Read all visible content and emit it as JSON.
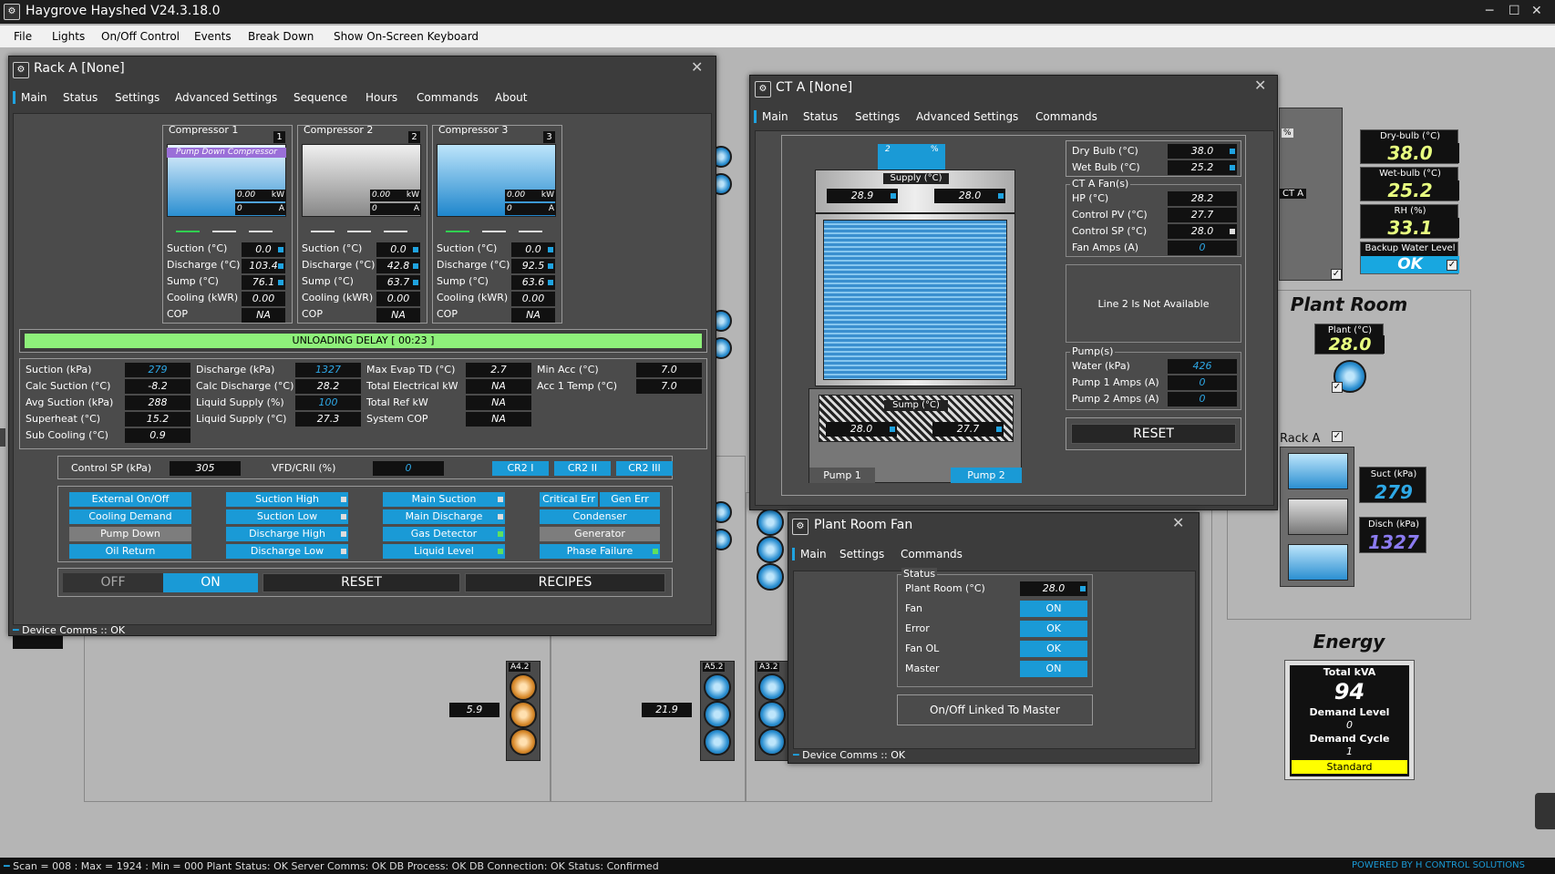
{
  "app": {
    "title": "Haygrove Hayshed V24.3.18.0",
    "menu": [
      "File",
      "Lights",
      "On/Off Control",
      "Events",
      "Break Down",
      "Show On-Screen Keyboard"
    ]
  },
  "rack_a": {
    "title": "Rack A [None]",
    "tabs": [
      "Main",
      "Status",
      "Settings",
      "Advanced Settings",
      "Sequence",
      "Hours",
      "Commands",
      "About"
    ],
    "compressors": [
      {
        "name": "Compressor 1",
        "num": "1",
        "banner": "Pump Down Compressor",
        "kw": "0.00",
        "a": "0",
        "suction": "0.0",
        "discharge": "103.4",
        "sump": "76.1",
        "cooling": "0.00",
        "cop": "NA"
      },
      {
        "name": "Compressor 2",
        "num": "2",
        "banner": "",
        "kw": "0.00",
        "a": "0",
        "suction": "0.0",
        "discharge": "42.8",
        "sump": "63.7",
        "cooling": "0.00",
        "cop": "NA"
      },
      {
        "name": "Compressor 3",
        "num": "3",
        "banner": "",
        "kw": "0.00",
        "a": "0",
        "suction": "0.0",
        "discharge": "92.5",
        "sump": "63.6",
        "cooling": "0.00",
        "cop": "NA"
      }
    ],
    "comp_labels": {
      "suction": "Suction (°C)",
      "discharge": "Discharge (°C)",
      "sump": "Sump (°C)",
      "cooling": "Cooling (kWR)",
      "cop": "COP",
      "kw_unit": "kW",
      "a_unit": "A"
    },
    "delay_banner": "UNLOADING DELAY [ 00:23 ]",
    "params": [
      [
        {
          "l": "Suction (kPa)",
          "v": "279",
          "c": "blue"
        },
        {
          "l": "Discharge (kPa)",
          "v": "1327",
          "c": "blue"
        },
        {
          "l": "Max Evap TD (°C)",
          "v": "2.7"
        },
        {
          "l": "Min Acc (°C)",
          "v": "7.0"
        }
      ],
      [
        {
          "l": "Calc Suction (°C)",
          "v": "-8.2"
        },
        {
          "l": "Calc Discharge (°C)",
          "v": "28.2"
        },
        {
          "l": "Total Electrical kW",
          "v": "NA"
        },
        {
          "l": "Acc 1 Temp (°C)",
          "v": "7.0"
        }
      ],
      [
        {
          "l": "Avg Suction (kPa)",
          "v": "288"
        },
        {
          "l": "Liquid Supply (%)",
          "v": "100",
          "c": "blue"
        },
        {
          "l": "Total Ref kW",
          "v": "NA"
        }
      ],
      [
        {
          "l": "Superheat (°C)",
          "v": "15.2"
        },
        {
          "l": "Liquid Supply (°C)",
          "v": "27.3"
        },
        {
          "l": "System COP",
          "v": "NA"
        }
      ],
      [
        {
          "l": "Sub Cooling (°C)",
          "v": "0.9"
        }
      ]
    ],
    "control_sp_label": "Control SP (kPa)",
    "control_sp": "305",
    "vfd_label": "VFD/CRII (%)",
    "vfd": "0",
    "cr": [
      "CR2 I",
      "CR2 II",
      "CR2 III"
    ],
    "status_buttons": [
      [
        "External On/Off",
        "Cooling Demand",
        "Pump Down",
        "Oil Return"
      ],
      [
        "Suction High",
        "Suction Low",
        "Discharge High",
        "Discharge Low"
      ],
      [
        "Main Suction",
        "Main Discharge",
        "Gas Detector",
        "Liquid Level"
      ],
      [
        "Critical Err",
        "Gen Err",
        "Condenser",
        "Generator",
        "Phase Failure"
      ]
    ],
    "off": "OFF",
    "on": "ON",
    "reset": "RESET",
    "recipes": "RECIPES",
    "comms": "Device Comms :: OK"
  },
  "ct_a": {
    "title": "CT A [None]",
    "tabs": [
      "Main",
      "Status",
      "Settings",
      "Advanced Settings",
      "Commands"
    ],
    "fan_pct": "2",
    "fan_unit": "%",
    "supply_label": "Supply (°C)",
    "supply": [
      "28.9",
      "28.0"
    ],
    "sump_label": "Sump (°C)",
    "sump": [
      "28.0",
      "27.7"
    ],
    "pump1": "Pump 1",
    "pump2": "Pump 2",
    "dry_bulb_label": "Dry Bulb (°C)",
    "dry_bulb": "38.0",
    "wet_bulb_label": "Wet Bulb (°C)",
    "wet_bulb": "25.2",
    "fans_group": "CT A Fan(s)",
    "fan_rows": [
      {
        "l": "HP (°C)",
        "v": "28.2"
      },
      {
        "l": "Control PV (°C)",
        "v": "27.7"
      },
      {
        "l": "Control SP (°C)",
        "v": "28.0"
      },
      {
        "l": "Fan Amps (A)",
        "v": "0"
      }
    ],
    "line2": "Line 2 Is Not Available",
    "pumps_group": "Pump(s)",
    "pump_rows": [
      {
        "l": "Water (kPa)",
        "v": "426"
      },
      {
        "l": "Pump 1 Amps (A)",
        "v": "0"
      },
      {
        "l": "Pump 2 Amps (A)",
        "v": "0"
      }
    ],
    "reset": "RESET"
  },
  "plant_fan": {
    "title": "Plant Room Fan",
    "tabs": [
      "Main",
      "Settings",
      "Commands"
    ],
    "group": "Status",
    "rows": [
      {
        "l": "Plant Room (°C)",
        "v": "28.0"
      },
      {
        "l": "Fan",
        "v": "ON"
      },
      {
        "l": "Error",
        "v": "OK"
      },
      {
        "l": "Fan OL",
        "v": "OK"
      },
      {
        "l": "Master",
        "v": "ON"
      }
    ],
    "linked": "On/Off Linked To Master",
    "comms": "Device Comms :: OK"
  },
  "side": {
    "dry_bulb_label": "Dry-bulb (°C)",
    "dry_bulb": "38.0",
    "wet_bulb_label": "Wet-bulb (°C)",
    "wet_bulb": "25.2",
    "rh_label": "RH (%)",
    "rh": "33.1",
    "backup_label": "Backup Water Level",
    "backup": "OK",
    "plant_room_title": "Plant Room",
    "plant_label": "Plant (°C)",
    "plant": "28.0",
    "rack_label": "Rack A",
    "suct_label": "Suct (kPa)",
    "suct": "279",
    "disch_label": "Disch (kPa)",
    "disch": "1327",
    "ct_label": "CT A",
    "ct_pct": "%",
    "energy_title": "Energy",
    "kva_label": "Total kVA",
    "kva": "94",
    "demand_level_label": "Demand Level",
    "demand_level": "0",
    "demand_cycle_label": "Demand Cycle",
    "demand_cycle": "1",
    "standard": "Standard"
  },
  "bg": {
    "a42": "A4.2",
    "a52": "A5.2",
    "a32": "A3.2",
    "v1": "5.9",
    "v2": "21.9",
    "comms": ""
  },
  "status": {
    "text": "Scan = 008 : Max = 1924 : Min = 000   Plant Status: OK   Server Comms: OK   DB Process:  OK   DB Connection:  OK   Status:  Confirmed",
    "powered": "POWERED BY H CONTROL SOLUTIONS"
  }
}
